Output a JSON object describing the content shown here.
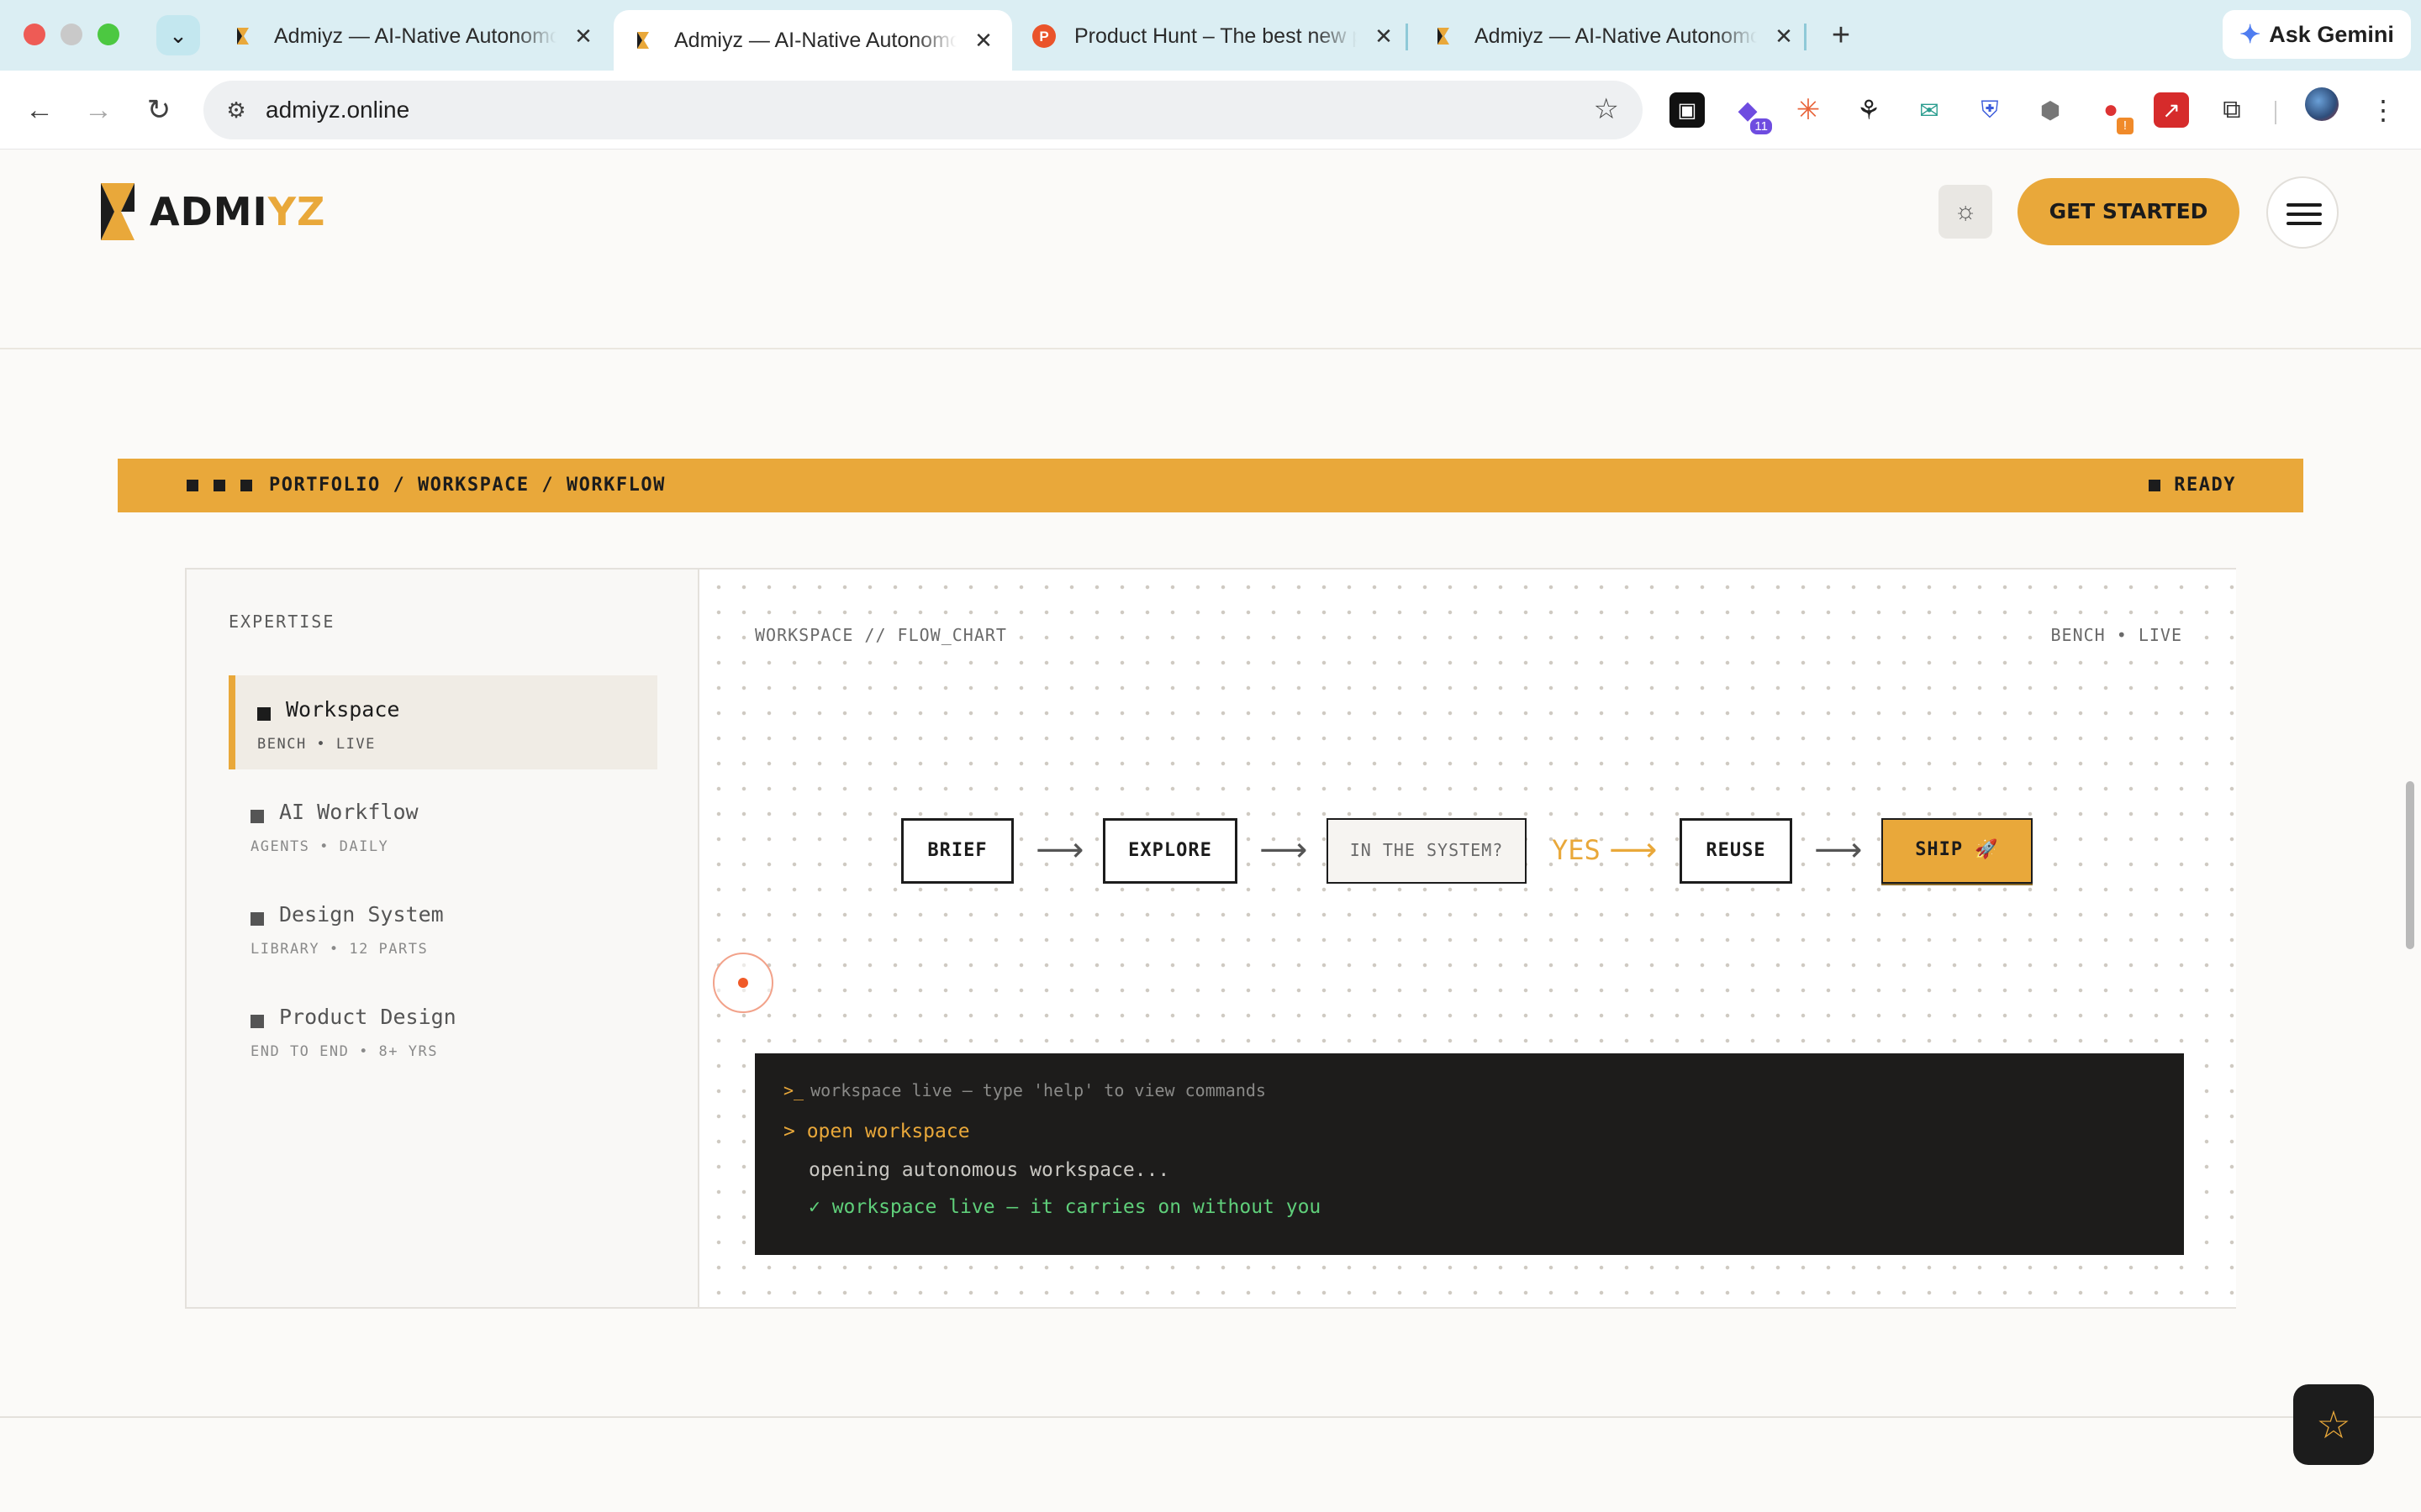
{
  "browser": {
    "tabs": [
      {
        "title": "Admiyz — AI-Native Autonomous Workspace",
        "active": false
      },
      {
        "title": "Admiyz — AI-Native Autonomous Workspace",
        "active": true
      },
      {
        "title": "Product Hunt – The best new products in tech",
        "active": false
      },
      {
        "title": "Admiyz — AI-Native Autonomous Workspace",
        "active": false
      }
    ],
    "close_glyph": "✕",
    "new_tab_glyph": "+",
    "gemini_label": "Ask Gemini",
    "url": "admiyz.online",
    "extension_badge_count": "11",
    "extension_warning": "!",
    "icons": [
      "tab-search-icon",
      "back-icon",
      "forward-icon",
      "reload-icon",
      "site-settings-icon",
      "bookmark-star-icon",
      "extensions-icon",
      "kebab-menu-icon"
    ]
  },
  "site": {
    "logo_main": "ADMI",
    "logo_accent": "YZ",
    "cta_label": "GET STARTED",
    "accent_color": "#e9a83a",
    "dark_color": "#1c1c1c"
  },
  "portfolio_bar": {
    "breadcrumb": "PORTFOLIO / WORKSPACE / WORKFLOW",
    "status": "READY"
  },
  "sidebar": {
    "heading": "EXPERTISE",
    "items": [
      {
        "label": "Workspace",
        "sub": "BENCH • LIVE",
        "active": true
      },
      {
        "label": "AI Workflow",
        "sub": "AGENTS • DAILY",
        "active": false
      },
      {
        "label": "Design System",
        "sub": "LIBRARY • 12 PARTS",
        "active": false
      },
      {
        "label": "Product Design",
        "sub": "END TO END • 8+ YRS",
        "active": false
      }
    ]
  },
  "canvas": {
    "label_left": "WORKSPACE // FLOW_CHART",
    "label_right": "BENCH • LIVE",
    "flow": {
      "brief": "BRIEF",
      "explore": "EXPLORE",
      "question": "IN THE SYSTEM?",
      "yes": "YES",
      "reuse": "REUSE",
      "ship": "SHIP 🚀"
    },
    "arrow_glyph": "⟶"
  },
  "terminal": {
    "prompt": ">_",
    "hint": "workspace live — type 'help' to view commands",
    "command": "> open workspace",
    "output": "opening autonomous workspace...",
    "success": "✓ workspace live — it carries on without you"
  },
  "fab_icon": "star-icon"
}
